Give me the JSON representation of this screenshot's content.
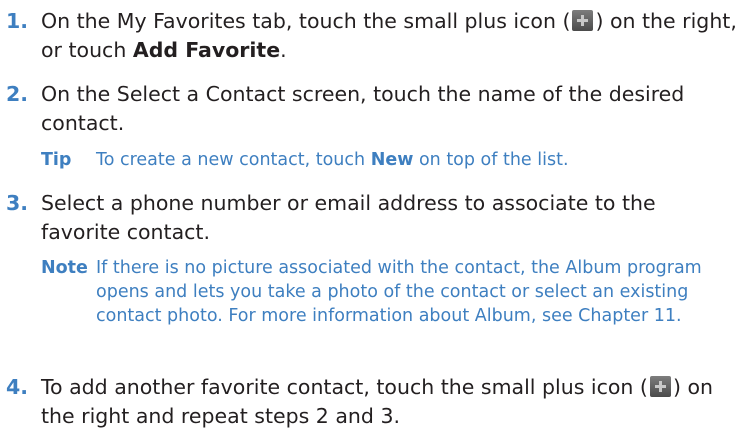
{
  "steps": [
    {
      "number": "1.",
      "text_before": "On the My Favorites tab, touch the small plus icon (",
      "text_after": ") on the right, or touch",
      "bold": "Add Favorite",
      "end": "."
    },
    {
      "number": "2.",
      "text": "On the Select a Contact screen, touch the name of the desired contact."
    },
    {
      "number": "3.",
      "text": "Select a phone number or email address to associate to the favorite contact."
    },
    {
      "number": "4.",
      "text_before": "To add another favorite contact, touch the small plus icon (",
      "text_after": ") on the right and repeat steps 2 and 3."
    }
  ],
  "tip": {
    "label": "Tip",
    "text_before": "To create a new contact, touch",
    "bold": "New",
    "text_after": "on top of the list."
  },
  "note": {
    "label": "Note",
    "text": "If there is no picture associated with the contact, the Album program opens and lets you take a photo of the contact or select an existing contact photo. For more information about Album, see Chapter 11."
  },
  "colors": {
    "accent": "#3e7fc0",
    "text": "#231f20",
    "icon": "#5a5a5a"
  },
  "icons": {
    "plus": "add-favorite-plus-icon"
  }
}
